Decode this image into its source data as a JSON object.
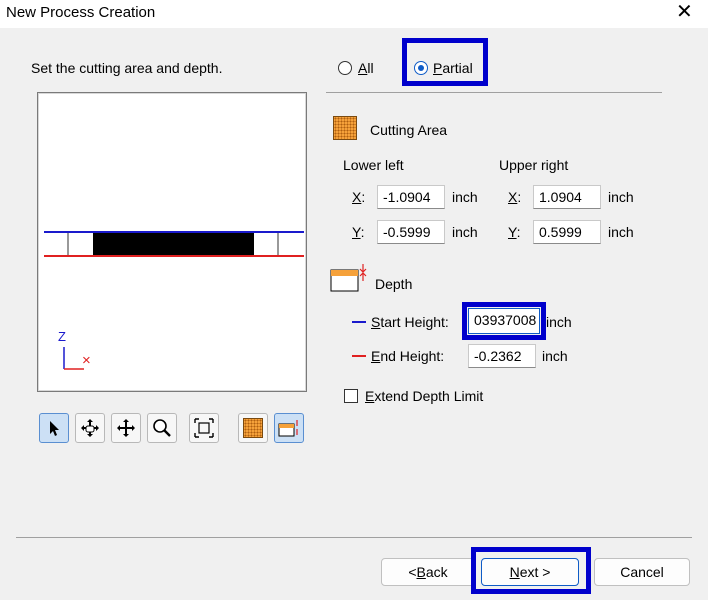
{
  "window": {
    "title": "New Process Creation",
    "close_glyph": "✕"
  },
  "instruction": "Set the cutting area and depth.",
  "mode": {
    "all_label": "All",
    "all_underline": "A",
    "all_rest": "ll",
    "partial_label": "Partial",
    "partial_underline": "P",
    "partial_rest": "artial",
    "selected": "Partial"
  },
  "cutting_area": {
    "label": "Cutting Area",
    "lower_left_label": "Lower left",
    "upper_right_label": "Upper right",
    "x_label": "X",
    "y_label": "Y",
    "colon": ":",
    "lower_left": {
      "x": "-1.0904",
      "y": "-0.5999"
    },
    "upper_right": {
      "x": "1.0904",
      "y": "0.5999"
    },
    "unit": "inch"
  },
  "depth": {
    "label": "Depth",
    "start_height_underline": "S",
    "start_height_rest": "tart Height:",
    "start_height_value": "03937008",
    "end_height_underline": "E",
    "end_height_rest": "nd Height:",
    "end_height_value": "-0.2362",
    "unit": "inch",
    "start_color": "#1a1acc",
    "end_color": "#e02020"
  },
  "extend_depth": {
    "underline": "E",
    "rest": "xtend Depth Limit",
    "checked": false
  },
  "preview": {
    "axis_z": "Z",
    "axis_x": "×"
  },
  "toolbar": [
    "select-icon",
    "pan-icon",
    "move-icon",
    "zoom-icon",
    "fit-icon",
    "cutting-area-icon",
    "depth-icon"
  ],
  "buttons": {
    "back_prefix": "< ",
    "back_underline": "B",
    "back_rest": "ack",
    "next_underline": "N",
    "next_rest": "ext >",
    "cancel": "Cancel"
  },
  "colors": {
    "highlight": "#0000cc",
    "accent": "#0f5cc7",
    "orange": "#f5a13a"
  }
}
